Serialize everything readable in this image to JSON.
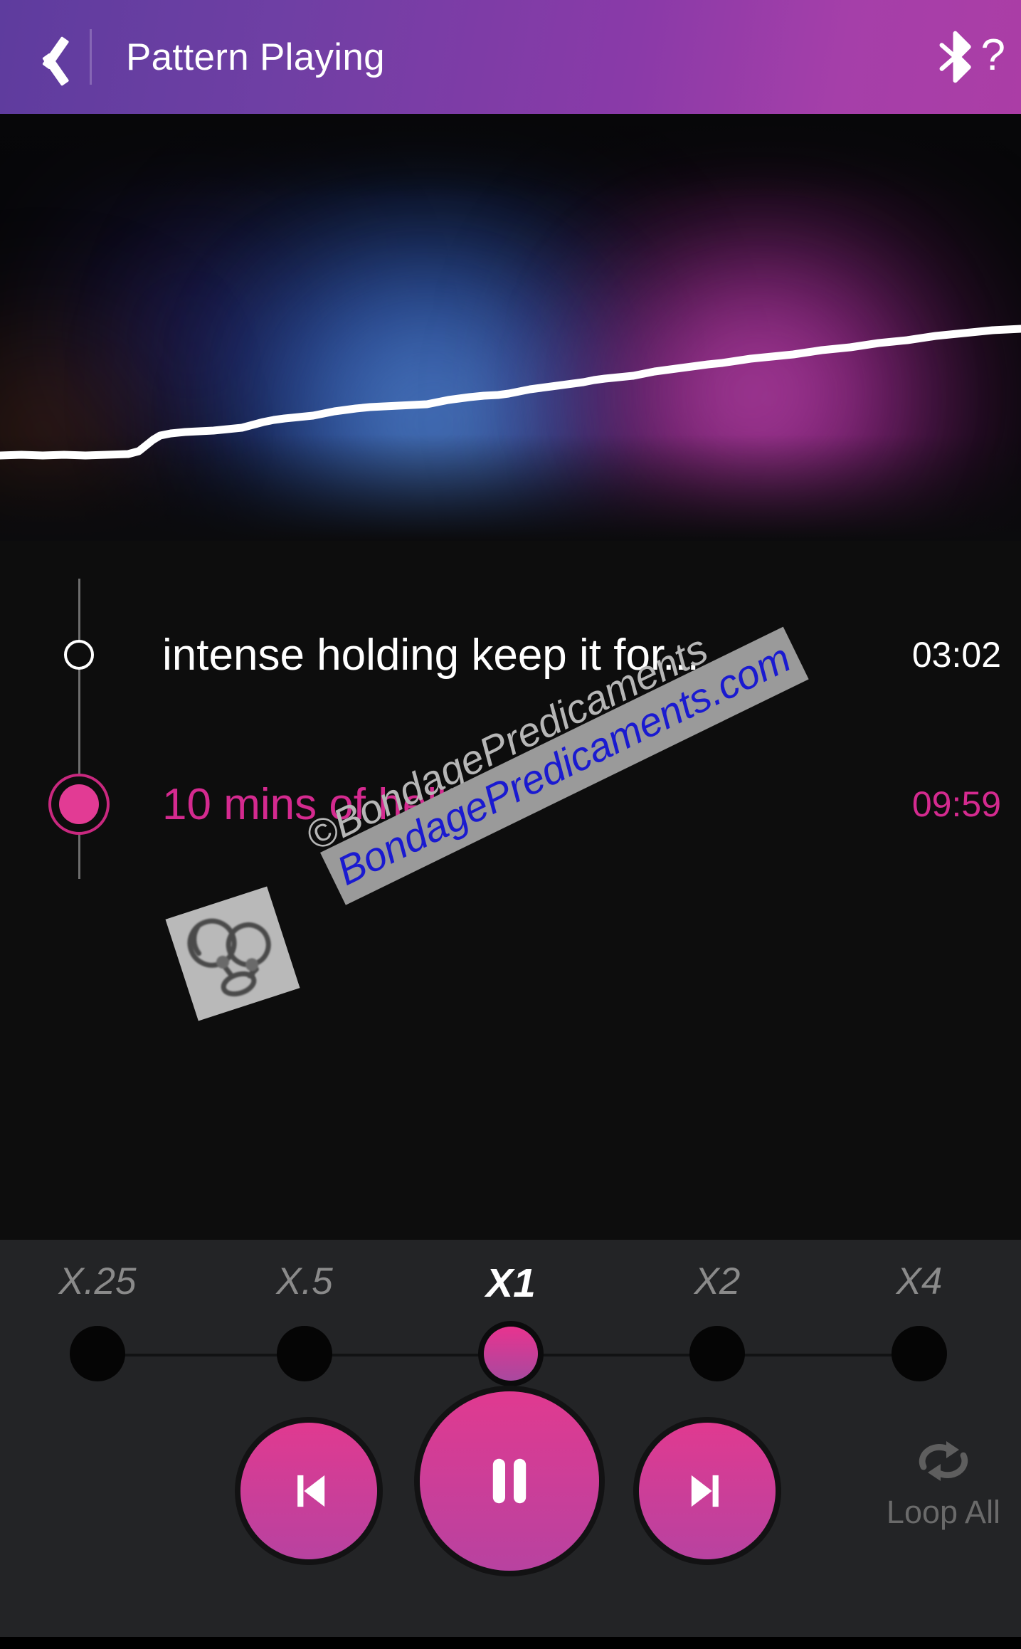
{
  "header": {
    "title": "Pattern Playing",
    "back_icon": "back-chevron-icon",
    "bluetooth_icon": "bluetooth-icon",
    "help_label": "?"
  },
  "visualizer": {
    "line_color": "#ffffff",
    "glow_colors": [
      "#2f5fbe",
      "#6ea5e1",
      "#d737be",
      "#e678d7",
      "#be5f2d"
    ],
    "background": "#070709"
  },
  "playlist": {
    "tracks": [
      {
        "name": "intense holding keep it for...",
        "duration": "03:02",
        "active": false,
        "color": "#ffffff",
        "marker": "hollow-circle"
      },
      {
        "name": "10 mins of hell",
        "duration": "09:59",
        "active": true,
        "color": "#d42a8f",
        "marker": "filled-circle"
      }
    ]
  },
  "watermark": {
    "line1": "©BondagePredicaments",
    "line2": "BondagePredicaments.com",
    "line1_color": "#b6b6b6",
    "line2_color": "#1a1ad0",
    "band_color": "#9a9a9a",
    "thumbnail_icon": "handcuffs-thumbnail"
  },
  "speed": {
    "options": [
      {
        "label": "X.25",
        "value": 0.25,
        "selected": false
      },
      {
        "label": "X.5",
        "value": 0.5,
        "selected": false
      },
      {
        "label": "X1",
        "value": 1,
        "selected": true
      },
      {
        "label": "X2",
        "value": 2,
        "selected": false
      },
      {
        "label": "X4",
        "value": 4,
        "selected": false
      }
    ],
    "selected_label": "X1",
    "accent": "#e8338f"
  },
  "transport": {
    "previous_icon": "skip-previous-icon",
    "play_pause_icon": "pause-icon",
    "next_icon": "skip-next-icon",
    "state": "playing",
    "button_color": "#e03a90",
    "loop": {
      "label": "Loop All",
      "icon": "repeat-icon",
      "color": "#6a6a6a"
    }
  }
}
